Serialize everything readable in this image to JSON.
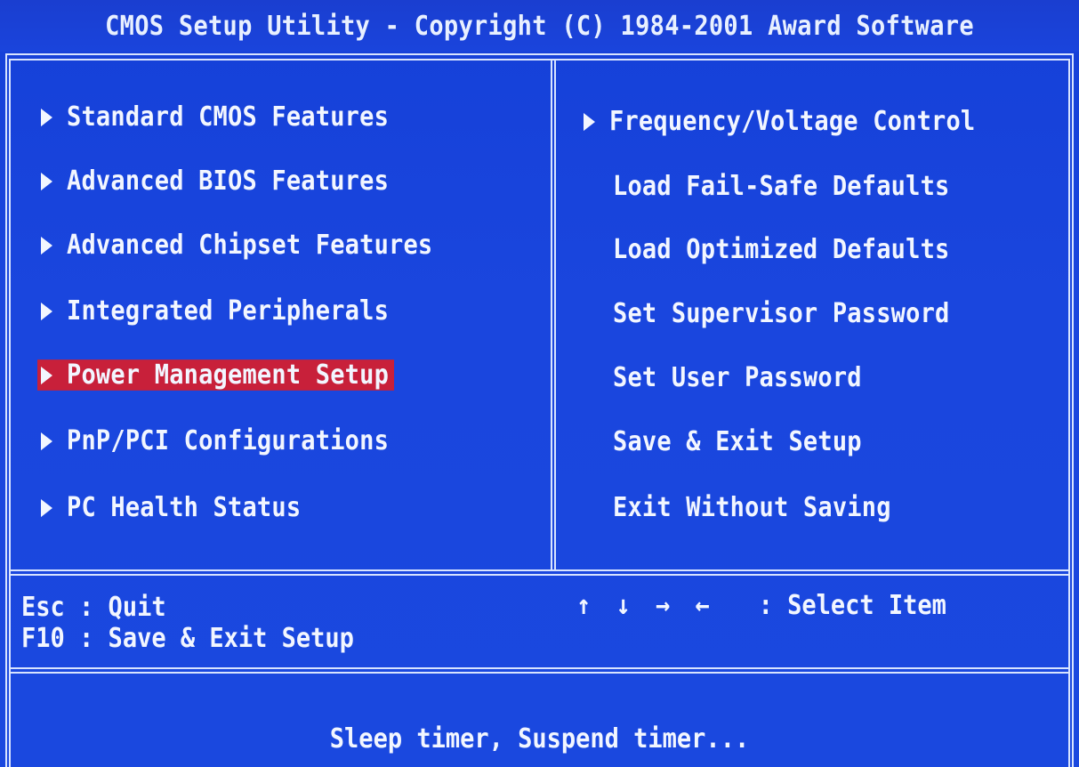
{
  "title": "CMOS Setup Utility - Copyright (C) 1984-2001 Award Software",
  "left_menu": [
    {
      "label": "Standard CMOS Features",
      "submenu": true,
      "selected": false
    },
    {
      "label": "Advanced BIOS Features",
      "submenu": true,
      "selected": false
    },
    {
      "label": "Advanced Chipset Features",
      "submenu": true,
      "selected": false
    },
    {
      "label": "Integrated Peripherals",
      "submenu": true,
      "selected": false
    },
    {
      "label": "Power Management Setup",
      "submenu": true,
      "selected": true
    },
    {
      "label": "PnP/PCI Configurations",
      "submenu": true,
      "selected": false
    },
    {
      "label": "PC Health Status",
      "submenu": true,
      "selected": false
    }
  ],
  "right_menu": [
    {
      "label": "Frequency/Voltage Control",
      "submenu": true
    },
    {
      "label": "Load Fail-Safe Defaults",
      "submenu": false
    },
    {
      "label": "Load Optimized Defaults",
      "submenu": false
    },
    {
      "label": "Set Supervisor Password",
      "submenu": false
    },
    {
      "label": "Set User Password",
      "submenu": false
    },
    {
      "label": "Save & Exit Setup",
      "submenu": false
    },
    {
      "label": "Exit Without Saving",
      "submenu": false
    }
  ],
  "footer": {
    "esc_key": "Esc",
    "esc_action": ": Quit",
    "f10_key": "F10",
    "f10_action": ": Save & Exit Setup",
    "arrows": "↑ ↓ → ←",
    "arrows_action": ": Select Item"
  },
  "help_text": "Sleep timer, Suspend timer...",
  "colors": {
    "background": "#1a46de",
    "text": "#f2f6ff",
    "highlight": "#c8203a",
    "frame": "#d8e4ff"
  }
}
